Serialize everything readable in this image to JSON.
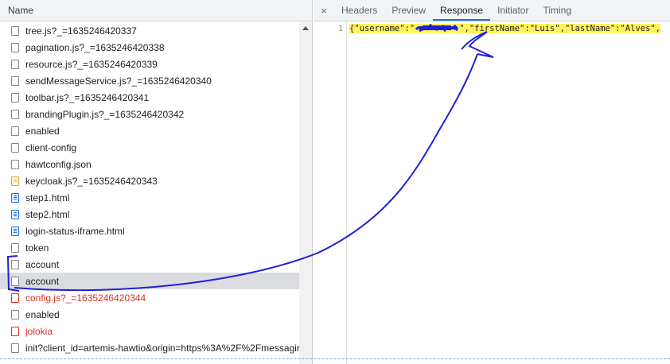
{
  "list": {
    "column_header": "Name",
    "requests": [
      {
        "name": "tree.js?_=1635246420337",
        "kind": "file"
      },
      {
        "name": "pagination.js?_=1635246420338",
        "kind": "file"
      },
      {
        "name": "resource.js?_=1635246420339",
        "kind": "file"
      },
      {
        "name": "sendMessageService.js?_=1635246420340",
        "kind": "file"
      },
      {
        "name": "toolbar.js?_=1635246420341",
        "kind": "file"
      },
      {
        "name": "brandingPlugin.js?_=1635246420342",
        "kind": "file"
      },
      {
        "name": "enabled",
        "kind": "file"
      },
      {
        "name": "client-config",
        "kind": "file"
      },
      {
        "name": "hawtconfig.json",
        "kind": "file"
      },
      {
        "name": "keycloak.js?_=1635246420343",
        "kind": "script"
      },
      {
        "name": "step1.html",
        "kind": "doc"
      },
      {
        "name": "step2.html",
        "kind": "doc"
      },
      {
        "name": "login-status-iframe.html",
        "kind": "doc"
      },
      {
        "name": "token",
        "kind": "file"
      },
      {
        "name": "account",
        "kind": "file"
      },
      {
        "name": "account",
        "kind": "file",
        "selected": true
      },
      {
        "name": "config.js?_=1635246420344",
        "kind": "error"
      },
      {
        "name": "enabled",
        "kind": "file"
      },
      {
        "name": "jolokia",
        "kind": "error"
      },
      {
        "name": "init?client_id=artemis-hawtio&origin=https%3A%2F%2Fmessagir",
        "kind": "file"
      }
    ]
  },
  "detail": {
    "close_glyph": "×",
    "tabs": [
      "Headers",
      "Preview",
      "Response",
      "Initiator",
      "Timing"
    ],
    "active_tab": "Response",
    "response": {
      "line_number": "1",
      "text_before": "{\"username\":\"",
      "text_after": "\",\"firstName\":\"Luis\",\"lastName\":\"Alves\",",
      "redaction_color": "#1f1fd6"
    }
  },
  "colors": {
    "selected_row": "#dadce0",
    "error_text": "#d93025",
    "accent": "#1a73e8",
    "highlight": "#fff25c",
    "ink": "#1f1fd6"
  }
}
